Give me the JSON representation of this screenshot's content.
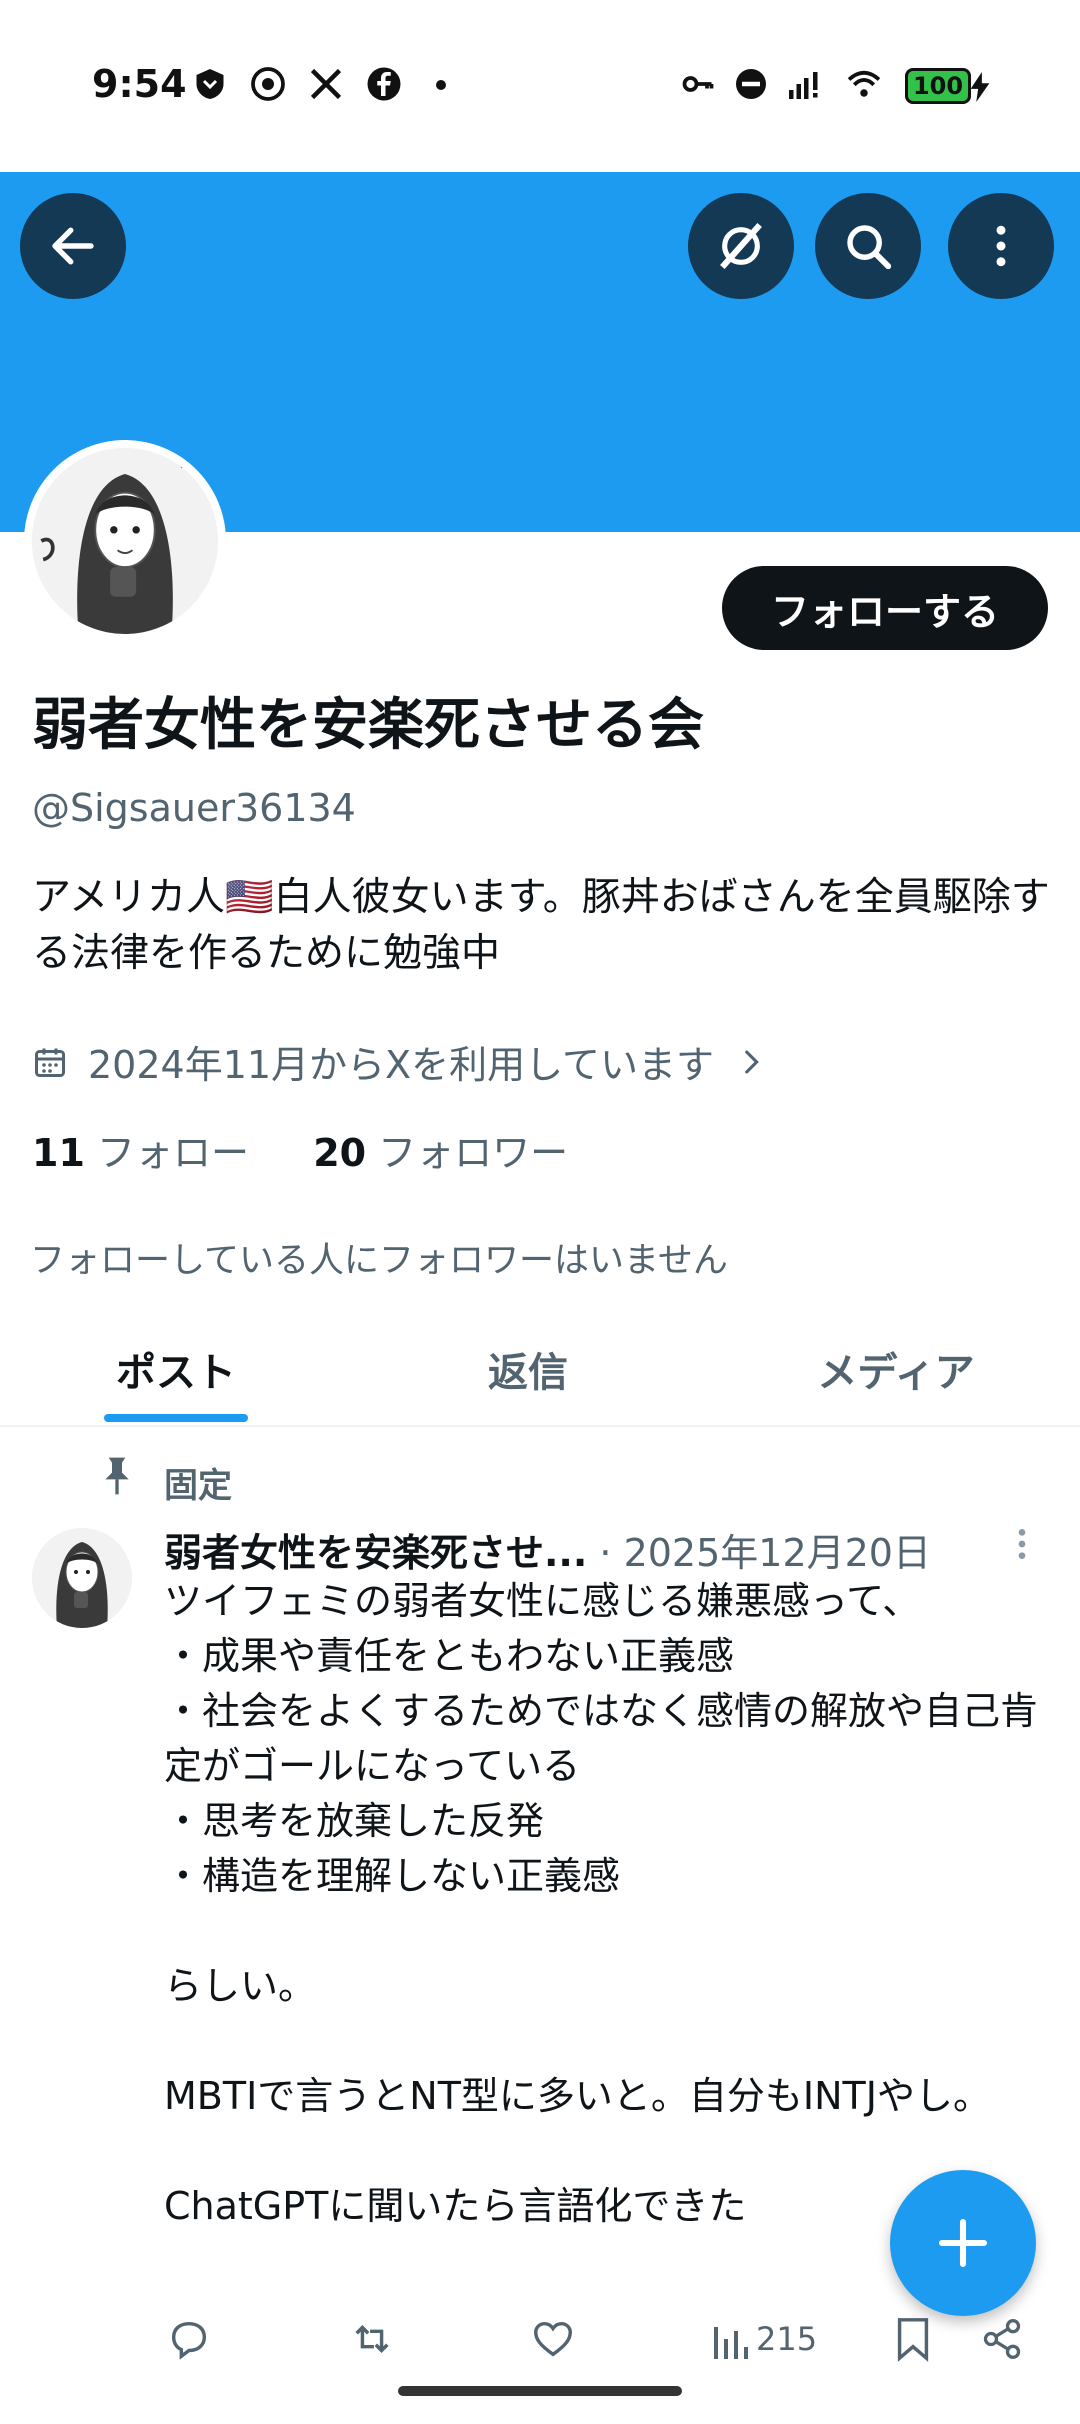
{
  "status_bar": {
    "time": "9:54",
    "battery": "100"
  },
  "colors": {
    "banner": "#1d9bf0",
    "accent": "#1d9bf0",
    "text": "#0f1419",
    "muted": "#536471"
  },
  "header": {
    "back_icon": "arrow-left-icon",
    "grok_icon": "grok-icon",
    "search_icon": "search-icon",
    "more_icon": "more-vertical-icon"
  },
  "profile": {
    "follow_label": "フォローする",
    "display_name": "弱者女性を安楽死させる会",
    "handle": "@Sigsauer36134",
    "bio": "アメリカ人🇺🇸白人彼女います。豚丼おばさんを全員駆除する法律を作るために勉強中",
    "joined": "2024年11月からXを利用しています",
    "following_count": "11",
    "following_label": "フォロー",
    "followers_count": "20",
    "followers_label": "フォロワー",
    "followers_you_know": "フォローしている人にフォロワーはいません"
  },
  "tabs": [
    {
      "label": "ポスト"
    },
    {
      "label": "返信"
    },
    {
      "label": "メディア"
    }
  ],
  "post": {
    "pinned_label": "固定",
    "author": "弱者女性を安楽死させ...",
    "date": "· 2025年12月20日",
    "text": "ツイフェミの弱者女性に感じる嫌悪感って、\n・成果や責任をともわない正義感\n・社会をよくするためではなく感情の解放や自己肯定がゴールになっている\n・思考を放棄した反発\n・構造を理解しない正義感\n\nらしい。\n\nMBTIで言うとNT型に多いと。自分もINTJやし。\n\nChatGPTに聞いたら言語化できた",
    "views": "215"
  }
}
